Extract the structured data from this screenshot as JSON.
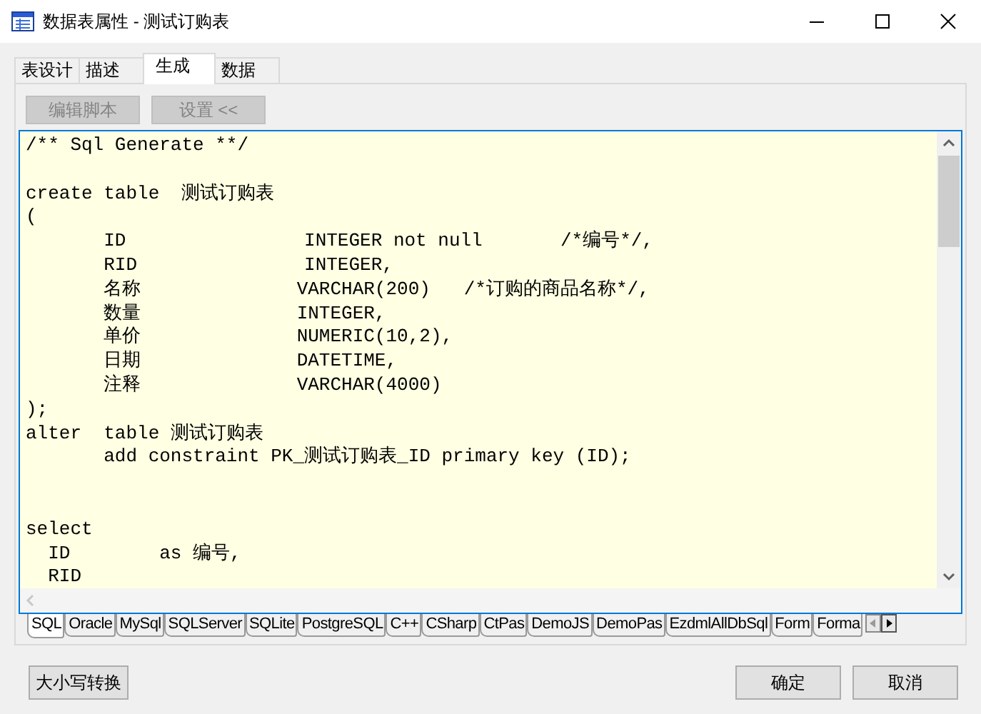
{
  "window": {
    "title": "数据表属性 - 测试订购表"
  },
  "tabs": [
    {
      "label": "表设计",
      "selected": false
    },
    {
      "label": "描述",
      "selected": false
    },
    {
      "label": "生成",
      "selected": true
    },
    {
      "label": "数据",
      "selected": false
    }
  ],
  "toolbar": [
    {
      "label": "编辑脚本",
      "disabled": true
    },
    {
      "label": "设置 <<",
      "disabled": true
    }
  ],
  "editor": {
    "code": "/** Sql Generate **/\n\ncreate table  测试订购表\n(\n       ID                INTEGER not null       /*编号*/,\n       RID               INTEGER,\n       名称              VARCHAR(200)   /*订购的商品名称*/,\n       数量              INTEGER,\n       单价              NUMERIC(10,2),\n       日期              DATETIME,\n       注释              VARCHAR(4000)\n);\nalter  table 测试订购表\n       add constraint PK_测试订购表_ID primary key (ID);\n\n\nselect\n  ID        as 编号,\n  RID"
  },
  "language_tabs": [
    {
      "label": "SQL",
      "selected": true
    },
    {
      "label": "Oracle",
      "selected": false
    },
    {
      "label": "MySql",
      "selected": false
    },
    {
      "label": "SQLServer",
      "selected": false
    },
    {
      "label": "SQLite",
      "selected": false
    },
    {
      "label": "PostgreSQL",
      "selected": false
    },
    {
      "label": "C++",
      "selected": false
    },
    {
      "label": "CSharp",
      "selected": false
    },
    {
      "label": "CtPas",
      "selected": false
    },
    {
      "label": "DemoJS",
      "selected": false
    },
    {
      "label": "DemoPas",
      "selected": false
    },
    {
      "label": "EzdmlAllDbSql",
      "selected": false
    },
    {
      "label": "Form",
      "selected": false
    },
    {
      "label": "Forma",
      "selected": false
    }
  ],
  "footer": {
    "case_button": "大小写转换",
    "ok_button": "确定",
    "cancel_button": "取消"
  }
}
